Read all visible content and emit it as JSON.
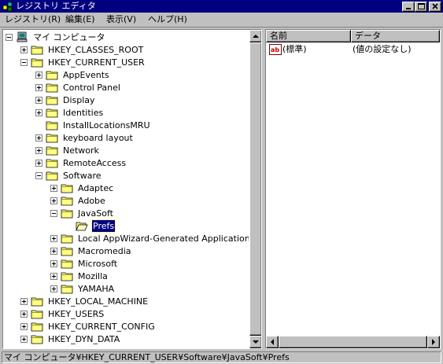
{
  "window": {
    "title": "レジストリ エディタ",
    "icon": "regedit-icon",
    "controls": [
      "minimize",
      "maximize",
      "close"
    ]
  },
  "menu": {
    "items": [
      "レジストリ(R)",
      "編集(E)",
      "表示(V)",
      "ヘルプ(H)"
    ]
  },
  "tree": {
    "root_label": "マイ コンピュータ",
    "nodes": [
      {
        "label": "HKEY_CLASSES_ROOT",
        "depth": 1,
        "expander": "plus"
      },
      {
        "label": "HKEY_CURRENT_USER",
        "depth": 1,
        "expander": "minus"
      },
      {
        "label": "AppEvents",
        "depth": 2,
        "expander": "plus"
      },
      {
        "label": "Control Panel",
        "depth": 2,
        "expander": "plus"
      },
      {
        "label": "Display",
        "depth": 2,
        "expander": "plus"
      },
      {
        "label": "Identities",
        "depth": 2,
        "expander": "plus"
      },
      {
        "label": "InstallLocationsMRU",
        "depth": 2,
        "expander": "none"
      },
      {
        "label": "keyboard layout",
        "depth": 2,
        "expander": "plus"
      },
      {
        "label": "Network",
        "depth": 2,
        "expander": "plus"
      },
      {
        "label": "RemoteAccess",
        "depth": 2,
        "expander": "plus"
      },
      {
        "label": "Software",
        "depth": 2,
        "expander": "minus"
      },
      {
        "label": "Adaptec",
        "depth": 3,
        "expander": "plus"
      },
      {
        "label": "Adobe",
        "depth": 3,
        "expander": "plus"
      },
      {
        "label": "JavaSoft",
        "depth": 3,
        "expander": "minus"
      },
      {
        "label": "Prefs",
        "depth": 4,
        "expander": "none",
        "selected": true
      },
      {
        "label": "Local AppWizard-Generated Applications",
        "depth": 3,
        "expander": "plus"
      },
      {
        "label": "Macromedia",
        "depth": 3,
        "expander": "plus"
      },
      {
        "label": "Microsoft",
        "depth": 3,
        "expander": "plus"
      },
      {
        "label": "Mozilla",
        "depth": 3,
        "expander": "plus"
      },
      {
        "label": "YAMAHA",
        "depth": 3,
        "expander": "plus"
      },
      {
        "label": "HKEY_LOCAL_MACHINE",
        "depth": 1,
        "expander": "plus"
      },
      {
        "label": "HKEY_USERS",
        "depth": 1,
        "expander": "plus"
      },
      {
        "label": "HKEY_CURRENT_CONFIG",
        "depth": 1,
        "expander": "plus"
      },
      {
        "label": "HKEY_DYN_DATA",
        "depth": 1,
        "expander": "plus"
      }
    ]
  },
  "list": {
    "columns": [
      "名前",
      "データ"
    ],
    "rows": [
      {
        "name": "(標準)",
        "data": "(値の設定なし)",
        "icon": "string-value-icon"
      }
    ]
  },
  "status": {
    "path": "マイ コンピュータ¥HKEY_CURRENT_USER¥Software¥JavaSoft¥Prefs"
  },
  "colors": {
    "face": "#c0c0c0",
    "titlebar": "#000080",
    "selection": "#000080",
    "folder": "#ffff80"
  }
}
